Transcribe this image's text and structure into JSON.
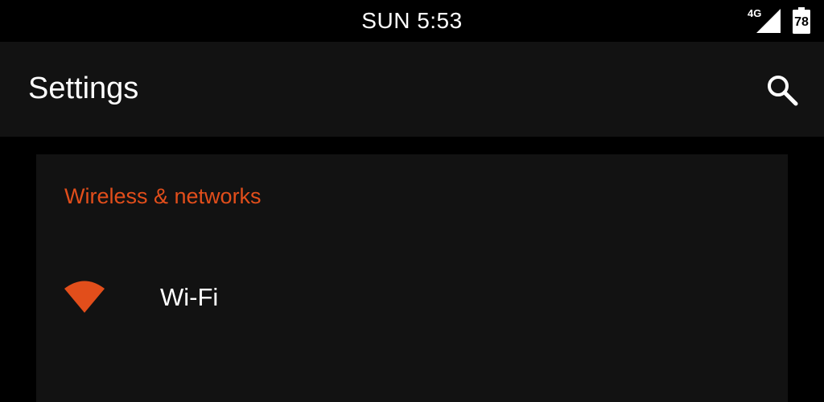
{
  "status_bar": {
    "time": "SUN 5:53",
    "network_type": "4G",
    "battery_level": "78",
    "icons": [
      "signal-icon",
      "battery-icon"
    ]
  },
  "app_bar": {
    "title": "Settings",
    "action_icon": "search-icon"
  },
  "sections": [
    {
      "header": "Wireless & networks",
      "items": [
        {
          "label": "Wi-Fi",
          "icon": "wifi-icon"
        }
      ]
    }
  ],
  "colors": {
    "accent": "#e24e1b",
    "surface": "#121212",
    "background": "#000000",
    "text": "#ffffff"
  }
}
